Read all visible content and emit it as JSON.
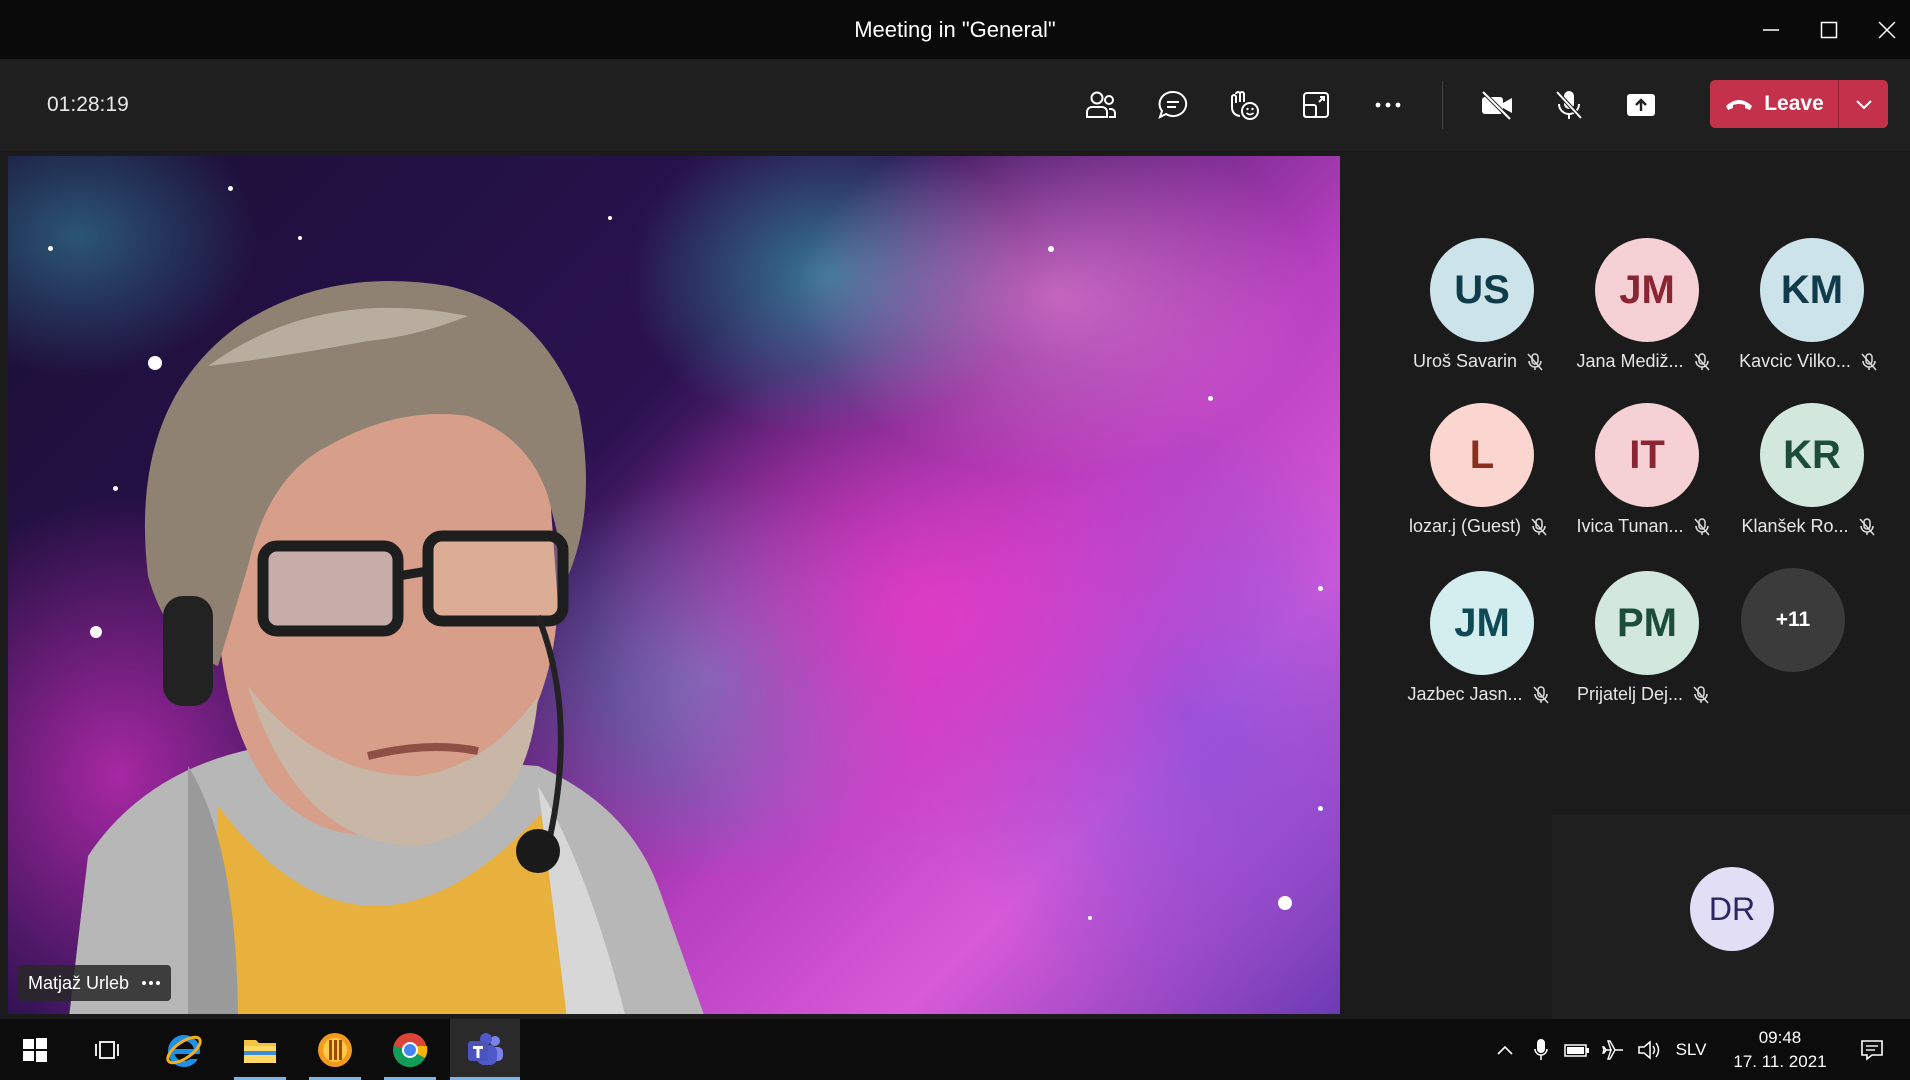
{
  "window": {
    "title": "Meeting in \"General\""
  },
  "toolbar": {
    "timer": "01:28:19",
    "leave_label": "Leave",
    "icons": [
      "people-icon",
      "chat-icon",
      "react-icon",
      "rooms-icon",
      "more-icon",
      "camera-off-icon",
      "mic-off-icon",
      "share-icon"
    ]
  },
  "video": {
    "speaker_name": "Matjaž Urleb"
  },
  "participants": [
    {
      "initials": "US",
      "name": "Uroš Savarin",
      "bg": "#cde3ea",
      "fg": "#0f3b4b"
    },
    {
      "initials": "JM",
      "name": "Jana Mediž...",
      "bg": "#f5d0d4",
      "fg": "#8a2533"
    },
    {
      "initials": "KM",
      "name": "Kavcic Vilko...",
      "bg": "#cde3ea",
      "fg": "#0f3b4b"
    },
    {
      "initials": "L",
      "name": "lozar.j (Guest)",
      "bg": "#fbd5cf",
      "fg": "#8a2f1f"
    },
    {
      "initials": "IT",
      "name": "Ivica Tunan...",
      "bg": "#f5d0d4",
      "fg": "#8a2533"
    },
    {
      "initials": "KR",
      "name": "Klanšek Ro...",
      "bg": "#d2e8dd",
      "fg": "#1d4d36"
    },
    {
      "initials": "JM",
      "name": "Jazbec Jasn...",
      "bg": "#d4eef0",
      "fg": "#0f4a55"
    },
    {
      "initials": "PM",
      "name": "Prijatelj Dej...",
      "bg": "#d2e8dd",
      "fg": "#1d4d36"
    }
  ],
  "overflow_count": "+11",
  "self_view": {
    "initials": "DR",
    "bg": "#e2def5",
    "fg": "#2b2561"
  },
  "taskbar": {
    "language": "SLV",
    "time": "09:48",
    "date": "17. 11. 2021"
  }
}
